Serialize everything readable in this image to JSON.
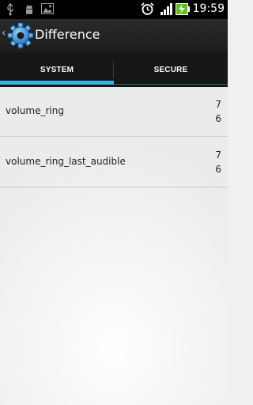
{
  "status_bar": {
    "time": "19:59",
    "icons": [
      "usb-icon",
      "android-debug-icon",
      "image-icon",
      "alarm-icon",
      "signal-icon",
      "battery-charging-icon"
    ]
  },
  "action_bar": {
    "title": "Difference",
    "back_symbol": "‹",
    "app_icon": "gear-icon"
  },
  "tabs": [
    {
      "label": "SYSTEM",
      "selected": true
    },
    {
      "label": "SECURE",
      "selected": false
    }
  ],
  "colors": {
    "accent": "#33b5e5",
    "battery": "#5ec11d"
  },
  "items": [
    {
      "name": "volume_ring",
      "value_a": "7",
      "value_b": "6"
    },
    {
      "name": "volume_ring_last_audible",
      "value_a": "7",
      "value_b": "6"
    }
  ]
}
